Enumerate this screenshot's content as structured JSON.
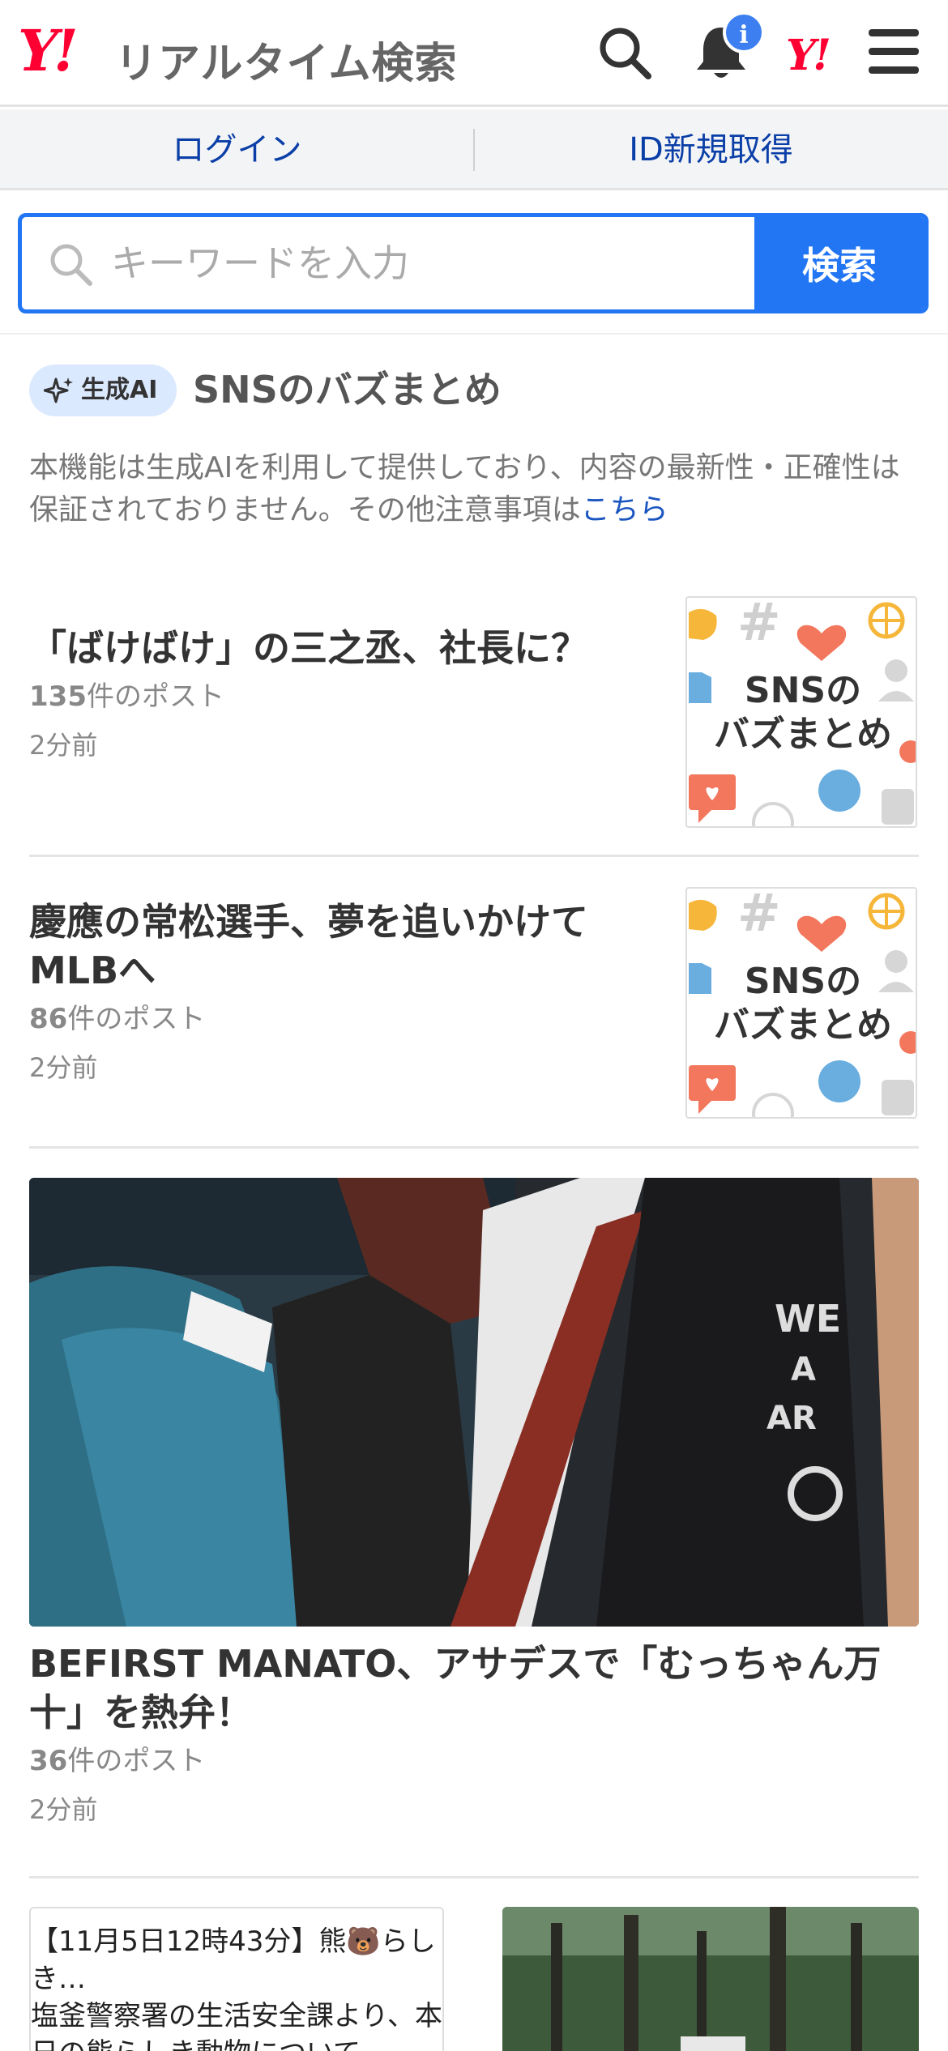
{
  "header": {
    "logo_mark": "Y!",
    "logo_text": "リアルタイム検索",
    "notification_badge": "i",
    "brand_mark": "Y!",
    "colors": {
      "brand": "#ff0033",
      "accent": "#2275f3"
    }
  },
  "auth": {
    "login": "ログイン",
    "signup": "ID新規取得"
  },
  "search": {
    "placeholder": "キーワードを入力",
    "button": "検索"
  },
  "ai_section": {
    "badge": "生成AI",
    "title": "SNSのバズまとめ",
    "disclaimer": "本機能は生成AIを利用して提供しており、内容の最新性・正確性は保証されておりません。その他注意事項は",
    "disclaimer_link": "こちら"
  },
  "articles": [
    {
      "title": "「ばけばけ」の三之丞、社長に？",
      "count": "135",
      "count_suffix": "件のポスト",
      "time": "2分前",
      "thumb_line1": "SNSの",
      "thumb_line2": "バズまとめ"
    },
    {
      "title": "慶應の常松選手、夢を追いかけてMLBへ",
      "count": "86",
      "count_suffix": "件のポスト",
      "time": "2分前",
      "thumb_line1": "SNSの",
      "thumb_line2": "バズまとめ"
    },
    {
      "title": "BEFIRST MANATO、アサデスで「むっちゃん万十」を熱弁！",
      "count": "36",
      "count_suffix": "件のポスト",
      "time": "2分前"
    }
  ],
  "cards": [
    {
      "line1": "【11月5日12時43分】熊🐻らしき…",
      "line2": "塩釜警察署の生活安全課より、本日の熊らしき動物について、"
    }
  ]
}
